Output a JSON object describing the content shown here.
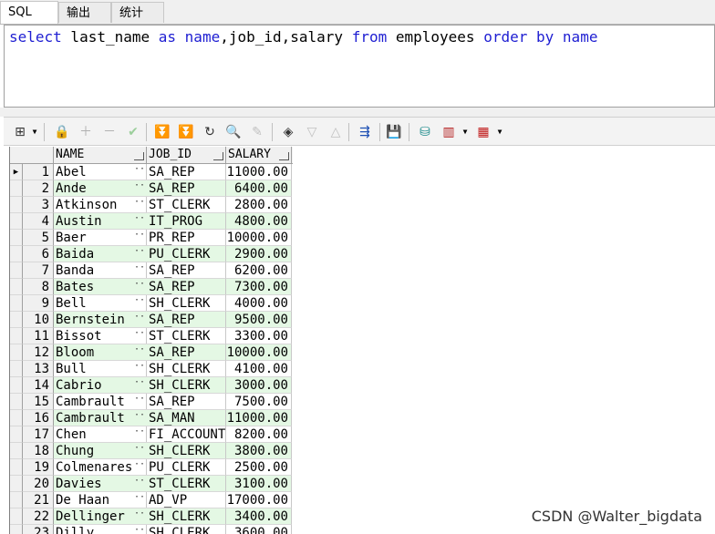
{
  "tabs": [
    "SQL",
    "输出",
    "统计"
  ],
  "sql": {
    "tokens": [
      {
        "t": "select",
        "k": true
      },
      {
        "t": " last_name ",
        "k": false
      },
      {
        "t": "as",
        "k": true
      },
      {
        "t": " ",
        "k": false
      },
      {
        "t": "name",
        "k": true
      },
      {
        "t": ",job_id,salary ",
        "k": false
      },
      {
        "t": "from",
        "k": true
      },
      {
        "t": " employees ",
        "k": false
      },
      {
        "t": "order",
        "k": true
      },
      {
        "t": " ",
        "k": false
      },
      {
        "t": "by",
        "k": true
      },
      {
        "t": " ",
        "k": false
      },
      {
        "t": "name",
        "k": true
      }
    ]
  },
  "columns": [
    "NAME",
    "JOB_ID",
    "SALARY"
  ],
  "rows": [
    [
      "1",
      "Abel",
      "SA_REP",
      "11000.00"
    ],
    [
      "2",
      "Ande",
      "SA_REP",
      "6400.00"
    ],
    [
      "3",
      "Atkinson",
      "ST_CLERK",
      "2800.00"
    ],
    [
      "4",
      "Austin",
      "IT_PROG",
      "4800.00"
    ],
    [
      "5",
      "Baer",
      "PR_REP",
      "10000.00"
    ],
    [
      "6",
      "Baida",
      "PU_CLERK",
      "2900.00"
    ],
    [
      "7",
      "Banda",
      "SA_REP",
      "6200.00"
    ],
    [
      "8",
      "Bates",
      "SA_REP",
      "7300.00"
    ],
    [
      "9",
      "Bell",
      "SH_CLERK",
      "4000.00"
    ],
    [
      "10",
      "Bernstein",
      "SA_REP",
      "9500.00"
    ],
    [
      "11",
      "Bissot",
      "ST_CLERK",
      "3300.00"
    ],
    [
      "12",
      "Bloom",
      "SA_REP",
      "10000.00"
    ],
    [
      "13",
      "Bull",
      "SH_CLERK",
      "4100.00"
    ],
    [
      "14",
      "Cabrio",
      "SH_CLERK",
      "3000.00"
    ],
    [
      "15",
      "Cambrault",
      "SA_REP",
      "7500.00"
    ],
    [
      "16",
      "Cambrault",
      "SA_MAN",
      "11000.00"
    ],
    [
      "17",
      "Chen",
      "FI_ACCOUNT",
      "8200.00"
    ],
    [
      "18",
      "Chung",
      "SH_CLERK",
      "3800.00"
    ],
    [
      "19",
      "Colmenares",
      "PU_CLERK",
      "2500.00"
    ],
    [
      "20",
      "Davies",
      "ST_CLERK",
      "3100.00"
    ],
    [
      "21",
      "De Haan",
      "AD_VP",
      "17000.00"
    ],
    [
      "22",
      "Dellinger",
      "SH_CLERK",
      "3400.00"
    ],
    [
      "23",
      "Dilly",
      "SH_CLERK",
      "3600.00"
    ]
  ],
  "current_row_marker": "▶",
  "watermark": "CSDN @Walter_bigdata",
  "colors": {
    "keyword": "#1e1ed2",
    "alt_row": "#e4f8e4"
  }
}
